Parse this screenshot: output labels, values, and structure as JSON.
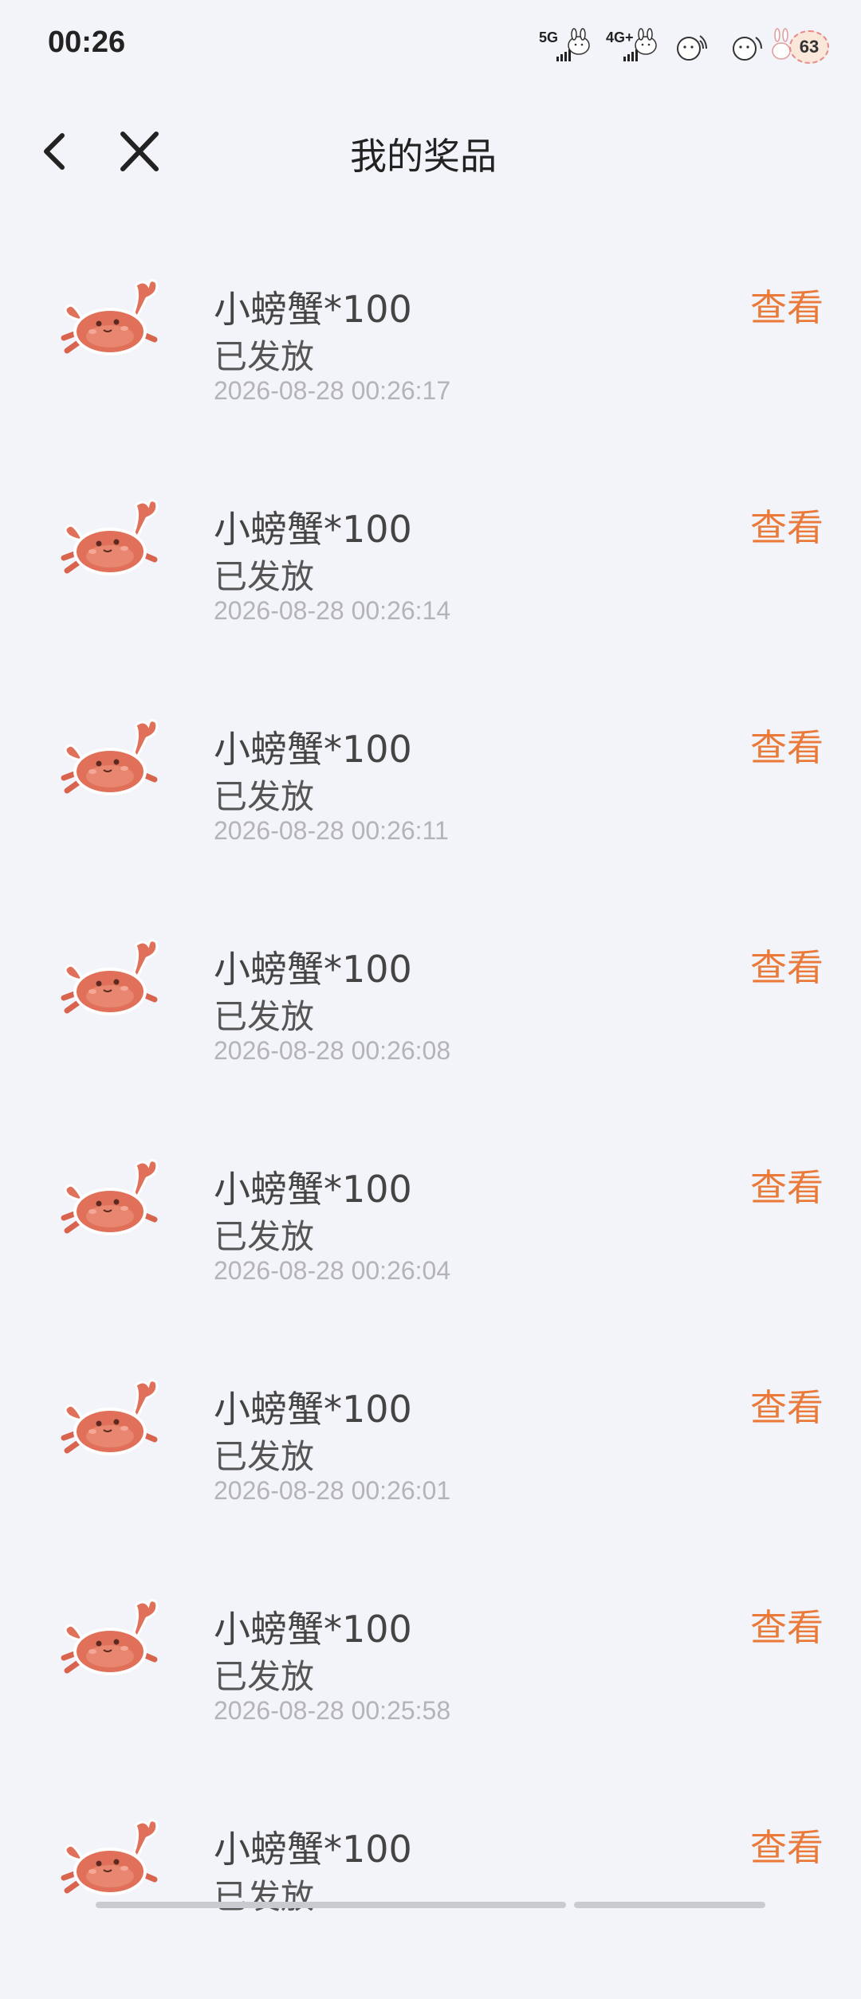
{
  "status_bar": {
    "time": "00:26",
    "network1": "5G",
    "network2": "4G+",
    "battery": "63"
  },
  "nav": {
    "title": "我的奖品"
  },
  "prizes": [
    {
      "name": "小螃蟹*100",
      "status": "已发放",
      "time": "2026-08-28 00:26:17",
      "action": "查看"
    },
    {
      "name": "小螃蟹*100",
      "status": "已发放",
      "time": "2026-08-28 00:26:14",
      "action": "查看"
    },
    {
      "name": "小螃蟹*100",
      "status": "已发放",
      "time": "2026-08-28 00:26:11",
      "action": "查看"
    },
    {
      "name": "小螃蟹*100",
      "status": "已发放",
      "time": "2026-08-28 00:26:08",
      "action": "查看"
    },
    {
      "name": "小螃蟹*100",
      "status": "已发放",
      "time": "2026-08-28 00:26:04",
      "action": "查看"
    },
    {
      "name": "小螃蟹*100",
      "status": "已发放",
      "time": "2026-08-28 00:26:01",
      "action": "查看"
    },
    {
      "name": "小螃蟹*100",
      "status": "已发放",
      "time": "2026-08-28 00:25:58",
      "action": "查看"
    },
    {
      "name": "小螃蟹*100",
      "status": "已发放",
      "time": "",
      "action": "查看"
    }
  ],
  "icons": {
    "prize": "crab-icon",
    "back": "chevron-left-icon",
    "close": "close-icon"
  },
  "colors": {
    "accent": "#ea7a3a",
    "background": "#f3f4f9",
    "crab": "#e0705a"
  }
}
